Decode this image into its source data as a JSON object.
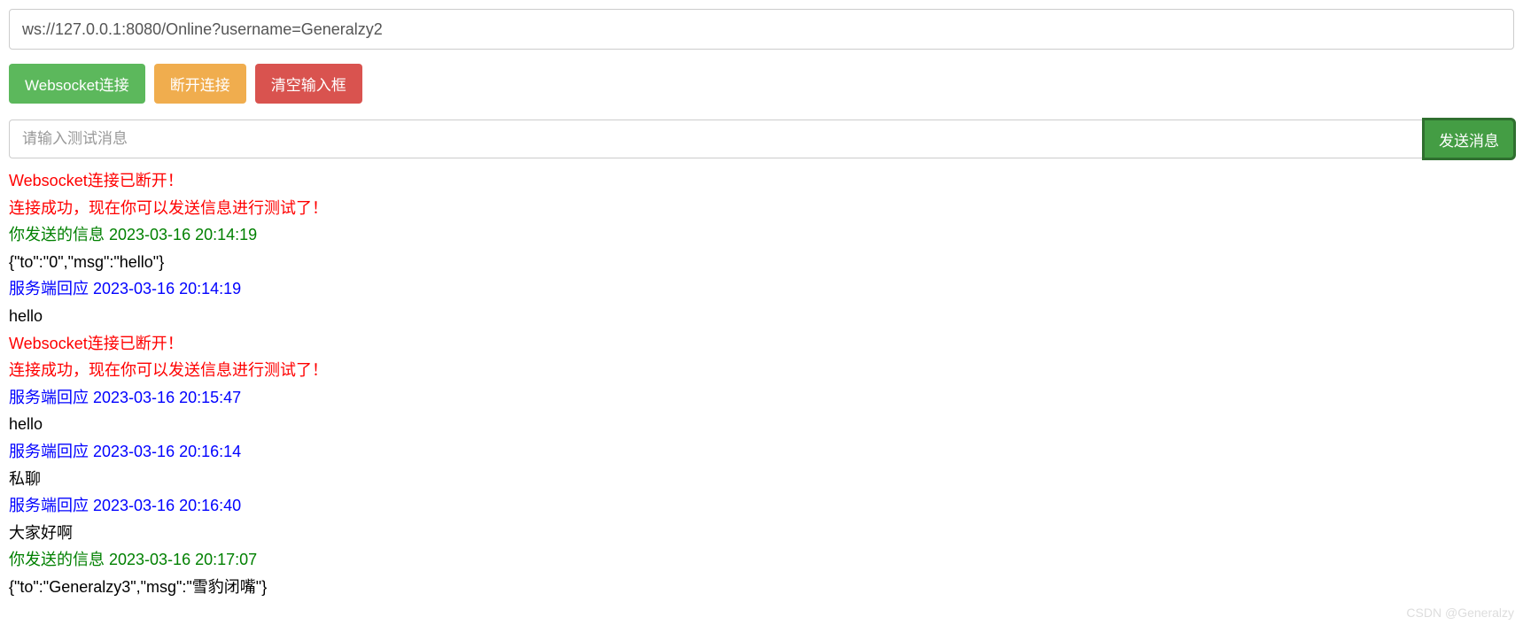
{
  "url_input": {
    "value": "ws://127.0.0.1:8080/Online?username=Generalzy2"
  },
  "buttons": {
    "connect": "Websocket连接",
    "disconnect": "断开连接",
    "clear": "清空输入框",
    "send": "发送消息"
  },
  "message_input": {
    "placeholder": "请输入测试消息",
    "value": ""
  },
  "log": [
    {
      "color": "red",
      "text": "Websocket连接已断开！"
    },
    {
      "color": "red",
      "text": "连接成功，现在你可以发送信息进行测试了！"
    },
    {
      "color": "green",
      "text": "你发送的信息 2023-03-16 20:14:19"
    },
    {
      "color": "black",
      "text": "{\"to\":\"0\",\"msg\":\"hello\"}"
    },
    {
      "color": "blue",
      "text": "服务端回应 2023-03-16 20:14:19"
    },
    {
      "color": "black",
      "text": "hello"
    },
    {
      "color": "red",
      "text": "Websocket连接已断开！"
    },
    {
      "color": "red",
      "text": "连接成功，现在你可以发送信息进行测试了！"
    },
    {
      "color": "blue",
      "text": "服务端回应 2023-03-16 20:15:47"
    },
    {
      "color": "black",
      "text": "hello"
    },
    {
      "color": "blue",
      "text": "服务端回应 2023-03-16 20:16:14"
    },
    {
      "color": "black",
      "text": "私聊"
    },
    {
      "color": "blue",
      "text": "服务端回应 2023-03-16 20:16:40"
    },
    {
      "color": "black",
      "text": "大家好啊"
    },
    {
      "color": "green",
      "text": "你发送的信息 2023-03-16 20:17:07"
    },
    {
      "color": "black",
      "text": "{\"to\":\"Generalzy3\",\"msg\":\"雪豹闭嘴\"}"
    }
  ],
  "watermark": "CSDN @Generalzy"
}
